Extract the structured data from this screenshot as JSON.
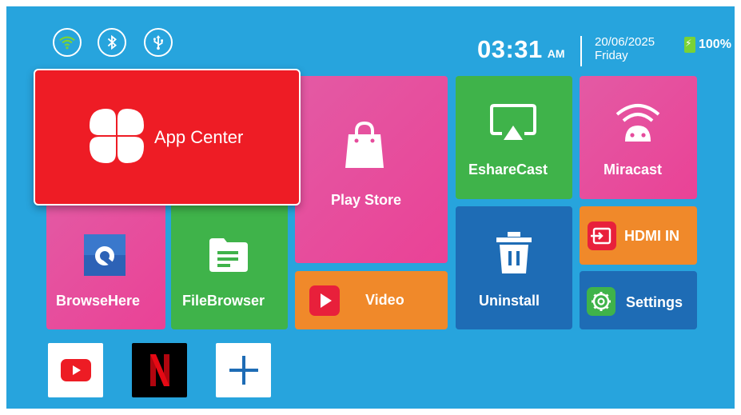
{
  "status": {
    "time": "03:31",
    "ampm": "AM",
    "date": "20/06/2025",
    "day": "Friday",
    "battery": "100%",
    "icons": [
      "wifi-icon",
      "bluetooth-icon",
      "usb-icon"
    ]
  },
  "tiles": {
    "app_center": "App Center",
    "play_store": "Play Store",
    "esharecast": "EshareCast",
    "miracast": "Miracast",
    "browsehere": "BrowseHere",
    "filebrowser": "FileBrowser",
    "video": "Video",
    "uninstall": "Uninstall",
    "hdmi_in": "HDMI IN",
    "settings": "Settings"
  },
  "dock": [
    "youtube-icon",
    "netflix-icon",
    "add-icon"
  ],
  "colors": {
    "background": "#27a4dd",
    "app_center": "#ee1c25",
    "pink": "#e64c9c",
    "green": "#3fb34a",
    "orange": "#f0892a",
    "navy": "#1e6cb5"
  }
}
